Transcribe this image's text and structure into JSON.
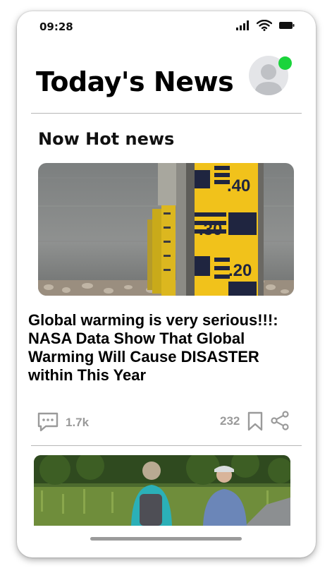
{
  "status_bar": {
    "time": "09:28"
  },
  "header": {
    "title": "Today's News"
  },
  "section": {
    "title": "Now Hot news"
  },
  "article": {
    "title": "Global warming is very serious!!!: NASA Data Show That Global Warming Will Cause DISASTER within This Year",
    "comments": "1.7k",
    "likes": "232"
  },
  "icons": {
    "signal": "signal-icon",
    "wifi": "wifi-icon",
    "battery": "battery-icon",
    "comment": "comment-icon",
    "bookmark": "bookmark-icon",
    "share": "share-icon"
  },
  "colors": {
    "online": "#1ad43b",
    "meta_text": "#9a9a9a",
    "gauge_yellow": "#f1c21b"
  }
}
